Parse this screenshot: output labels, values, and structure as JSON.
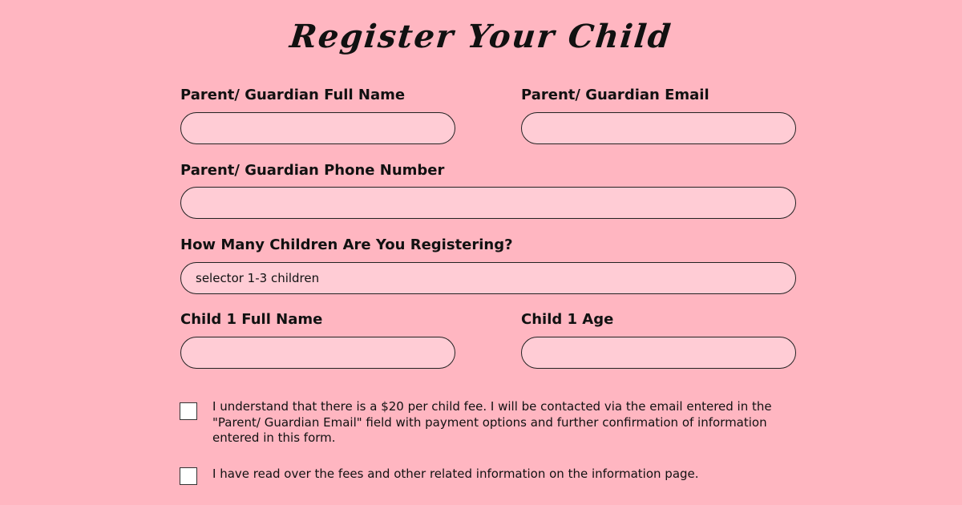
{
  "form": {
    "title": "Register Your Child",
    "parent_name_label": "Parent/ Guardian Full Name",
    "parent_email_label": "Parent/ Guardian Email",
    "parent_phone_label": "Parent/ Guardian Phone Number",
    "children_count_label": "How Many Children Are You Registering?",
    "children_count_value": "selector 1-3 children",
    "child1_name_label": "Child 1 Full Name",
    "child1_age_label": "Child 1 Age",
    "fee_ack_text": "I understand that there is a $20 per child fee. I will be contacted via the email entered in the \"Parent/ Guardian Email\" field with payment options and further confirmation of information entered in this form.",
    "info_ack_text": "I have read over the fees and other related information on the information page.",
    "fee_ack_checked": false,
    "info_ack_checked": false
  },
  "colors": {
    "background": "#ffb6c1",
    "field_fill": "#ffccd5",
    "field_border": "#222222"
  }
}
